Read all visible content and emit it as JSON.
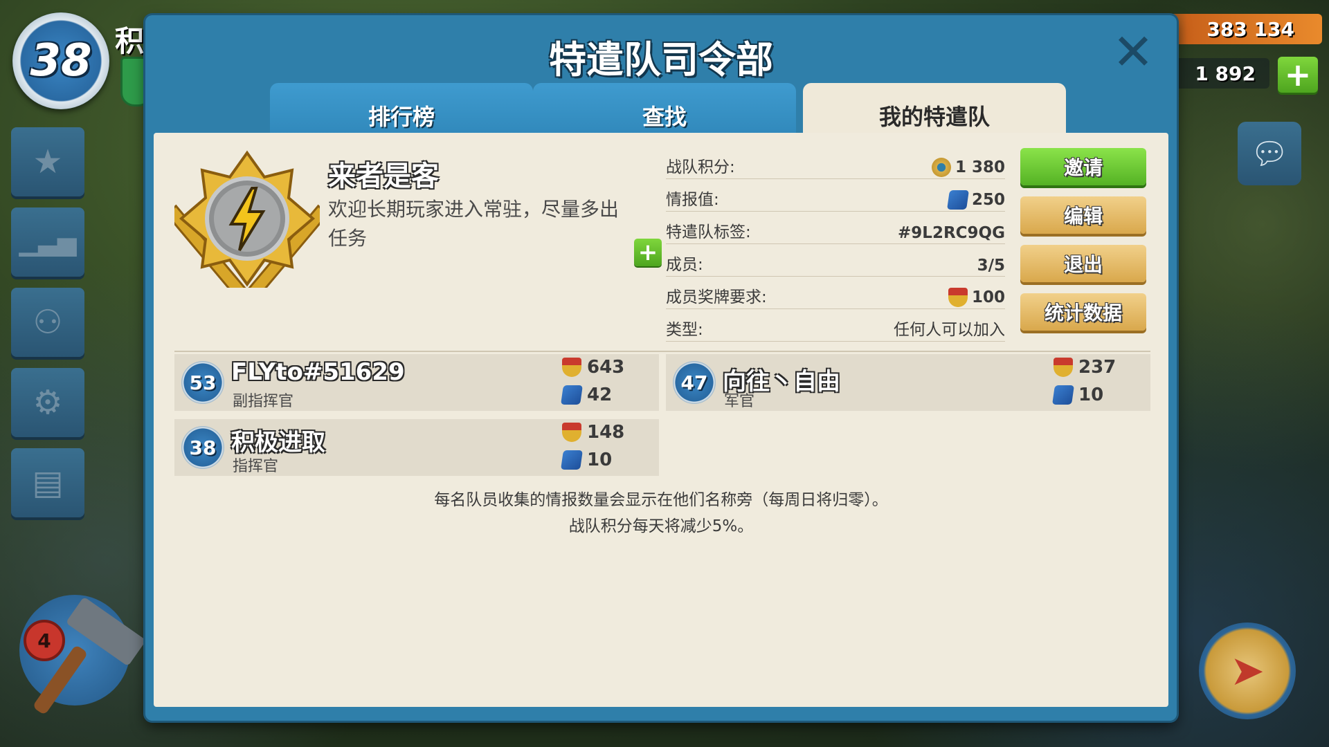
{
  "hud": {
    "player_level": "38",
    "player_name": "积",
    "gold": "383 134",
    "diamonds": "1 892",
    "builders": "4"
  },
  "panel": {
    "title": "特遣队司令部",
    "tabs": [
      {
        "label": "排行榜",
        "active": false
      },
      {
        "label": "查找",
        "active": false
      },
      {
        "label": "我的特遣队",
        "active": true
      }
    ]
  },
  "team": {
    "name": "来者是客",
    "description": "欢迎长期玩家进入常驻，尽量多出任务",
    "info": {
      "score_label": "战队积分:",
      "score_value": "1 380",
      "intel_label": "情报值:",
      "intel_value": "250",
      "tag_label": "特遣队标签:",
      "tag_value": "#9L2RC9QG",
      "members_label": "成员:",
      "members_value": "3/5",
      "medal_req_label": "成员奖牌要求:",
      "medal_req_value": "100",
      "type_label": "类型:",
      "type_value": "任何人可以加入"
    }
  },
  "buttons": {
    "invite": "邀请",
    "edit": "编辑",
    "leave": "退出",
    "stats": "统计数据"
  },
  "members": [
    {
      "level": "53",
      "name": "FLYto#51629",
      "role": "副指挥官",
      "medals": "643",
      "intel": "42"
    },
    {
      "level": "47",
      "name": "向往丶自由",
      "role": "军官",
      "medals": "237",
      "intel": "10"
    },
    {
      "level": "38",
      "name": "积极进取",
      "role": "指挥官",
      "medals": "148",
      "intel": "10"
    }
  ],
  "footer": {
    "line1": "每名队员收集的情报数量会显示在他们名称旁（每周日将归零）。",
    "line2": "战队积分每天将减少5%。"
  },
  "colors": {
    "panel_blue": "#2f7faa",
    "content_bg": "#f0ebdd",
    "invite_green": "#55b224",
    "gold_button": "#d9a84c"
  },
  "icons": [
    "close-icon",
    "star-icon",
    "leaderboard-icon",
    "team-icon",
    "gear-icon",
    "news-icon",
    "chat-icon",
    "hammer-icon",
    "compass-icon",
    "medal-icon",
    "intel-icon",
    "plus-icon"
  ]
}
